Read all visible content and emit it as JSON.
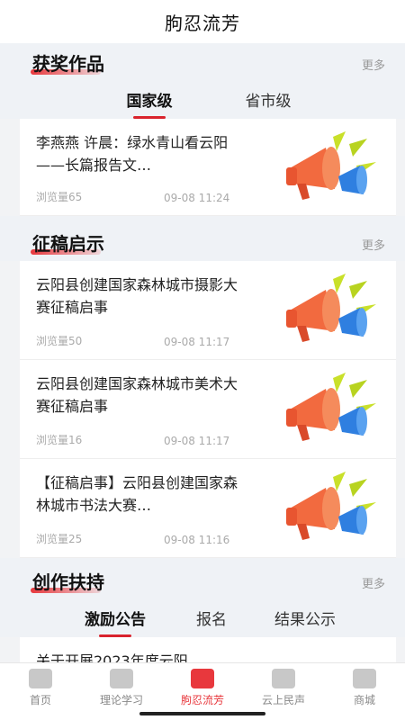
{
  "header": {
    "title": "朐忍流芳"
  },
  "awards": {
    "title": "获奖作品",
    "more": "更多",
    "tabs": [
      "国家级",
      "省市级"
    ],
    "items": [
      {
        "title": "李燕燕 许晨：绿水青山看云阳——长篇报告文…",
        "views": "浏览量65",
        "time": "09-08 11:24"
      }
    ]
  },
  "calls": {
    "title": "征稿启示",
    "more": "更多",
    "items": [
      {
        "title": "云阳县创建国家森林城市摄影大赛征稿启事",
        "views": "浏览量50",
        "time": "09-08 11:17"
      },
      {
        "title": "云阳县创建国家森林城市美术大赛征稿启事",
        "views": "浏览量16",
        "time": "09-08 11:17"
      },
      {
        "title": "【征稿启事】云阳县创建国家森林城市书法大赛…",
        "views": "浏览量25",
        "time": "09-08 11:16"
      }
    ]
  },
  "support": {
    "title": "创作扶持",
    "more": "更多",
    "tabs": [
      "激励公告",
      "报名",
      "结果公示"
    ],
    "items": [
      {
        "title": "关于开展2023年度云阳"
      }
    ]
  },
  "nav": {
    "items": [
      {
        "label": "首页",
        "icon": "home-icon"
      },
      {
        "label": "理论学习",
        "icon": "heart-book-icon"
      },
      {
        "label": "朐忍流芳",
        "icon": "ticket-star-icon"
      },
      {
        "label": "云上民声",
        "icon": "chat-icon"
      },
      {
        "label": "商城",
        "icon": "shop-icon"
      }
    ],
    "active_index": 2
  },
  "colors": {
    "accent": "#e8383d",
    "background": "#f2f3f5"
  }
}
